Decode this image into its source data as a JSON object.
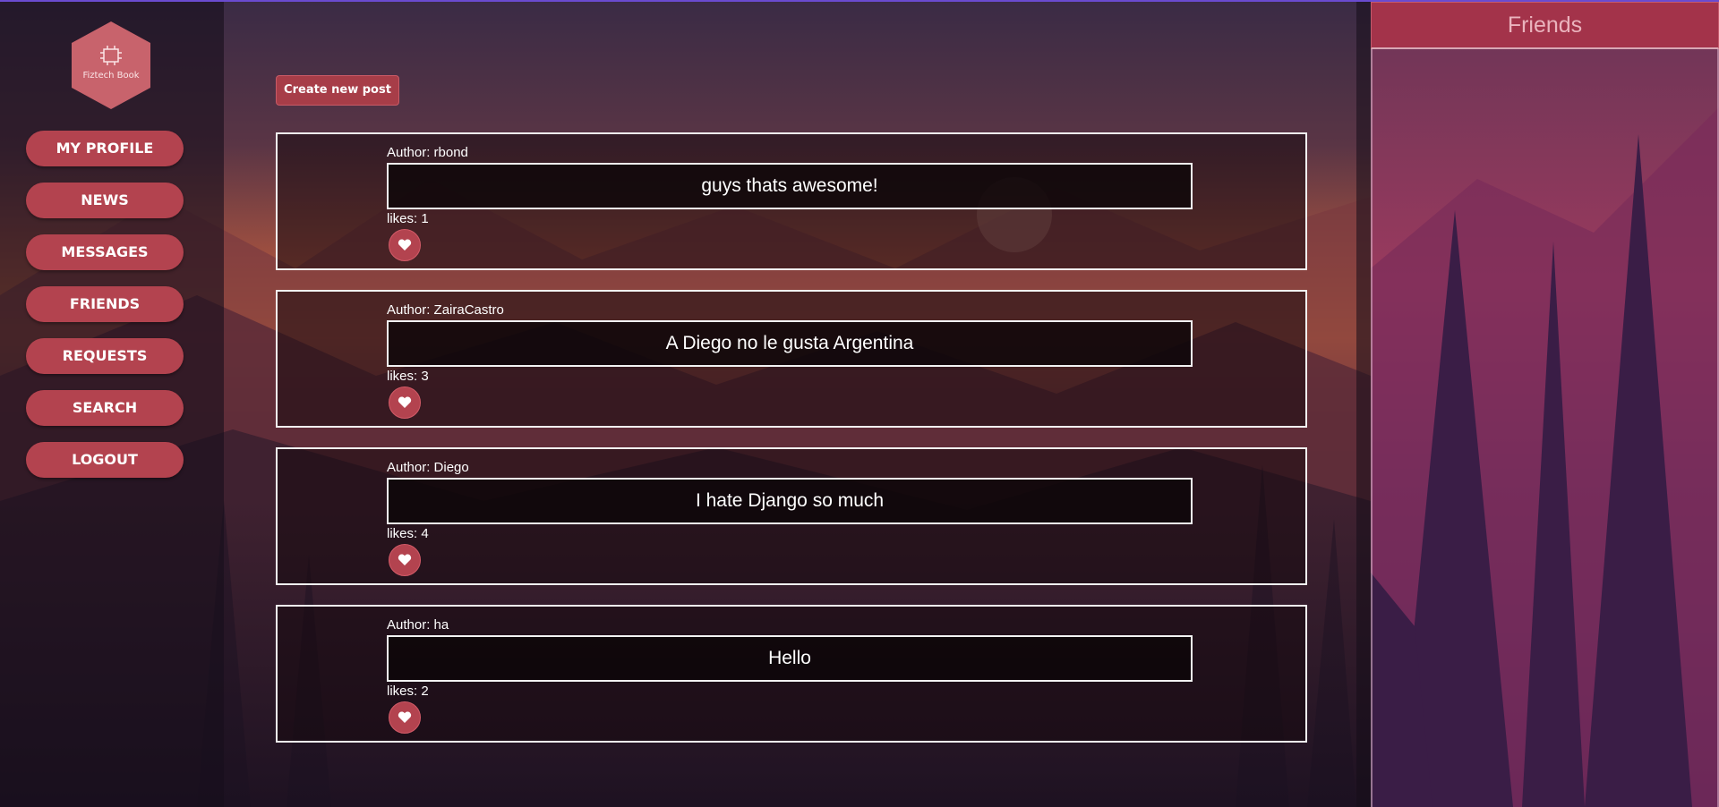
{
  "app": {
    "logo_text": "Fiztech Book"
  },
  "sidebar": {
    "items": [
      {
        "label": "MY PROFILE"
      },
      {
        "label": "NEWS"
      },
      {
        "label": "MESSAGES"
      },
      {
        "label": "FRIENDS"
      },
      {
        "label": "REQUESTS"
      },
      {
        "label": "SEARCH"
      },
      {
        "label": "LOGOUT"
      }
    ]
  },
  "main": {
    "create_post_label": "Create new post",
    "posts": [
      {
        "author": "Author: rbond",
        "text": "guys thats awesome!",
        "likes": "likes: 1"
      },
      {
        "author": "Author: ZairaCastro",
        "text": "A Diego no le gusta Argentina",
        "likes": "likes: 3"
      },
      {
        "author": "Author: Diego",
        "text": "I hate Django so much",
        "likes": "likes: 4"
      },
      {
        "author": "Author: ha",
        "text": "Hello",
        "likes": "likes: 2"
      }
    ]
  },
  "friends": {
    "title": "Friends"
  },
  "icons": {
    "like": "heart-icon",
    "logo": "chip-icon"
  },
  "colors": {
    "accent": "#b3434f",
    "friends_header": "#a3334a",
    "top_line": "#6a4bd0"
  }
}
